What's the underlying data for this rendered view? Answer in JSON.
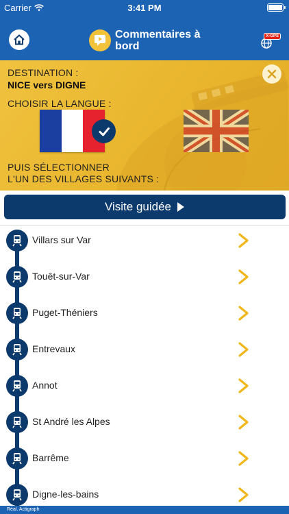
{
  "status": {
    "carrier": "Carrier",
    "time": "3:41 PM"
  },
  "header": {
    "title": "Commentaires à bord",
    "gps_badge": "X-GPS",
    "icons": {
      "home": "home-icon",
      "brand": "speech-bubble-icon",
      "gps": "globe-gps-icon"
    }
  },
  "hero": {
    "destination_label": "DESTINATION :",
    "destination_value": "NICE vers DIGNE",
    "language_label": "CHOISIR LA LANGUE :",
    "select_line1": "PUIS SÉLECTIONNER",
    "select_line2": "L'UN DES VILLAGES SUIVANTS :",
    "languages": [
      {
        "code": "fr",
        "selected": true
      },
      {
        "code": "en",
        "selected": false
      }
    ]
  },
  "visit_button": {
    "label": "Visite guidée"
  },
  "villages": [
    {
      "name": "Villars sur Var"
    },
    {
      "name": "Touêt-sur-Var"
    },
    {
      "name": "Puget-Théniers"
    },
    {
      "name": "Entrevaux"
    },
    {
      "name": "Annot"
    },
    {
      "name": "St André les Alpes"
    },
    {
      "name": "Barrême"
    },
    {
      "name": "Digne-les-bains"
    }
  ],
  "footer": {
    "credit": "Réal. Actigraph"
  },
  "colors": {
    "header": "#1d63b3",
    "navy": "#0d3a6c",
    "gold": "#f0c23f",
    "chevron": "#f1b61a"
  }
}
